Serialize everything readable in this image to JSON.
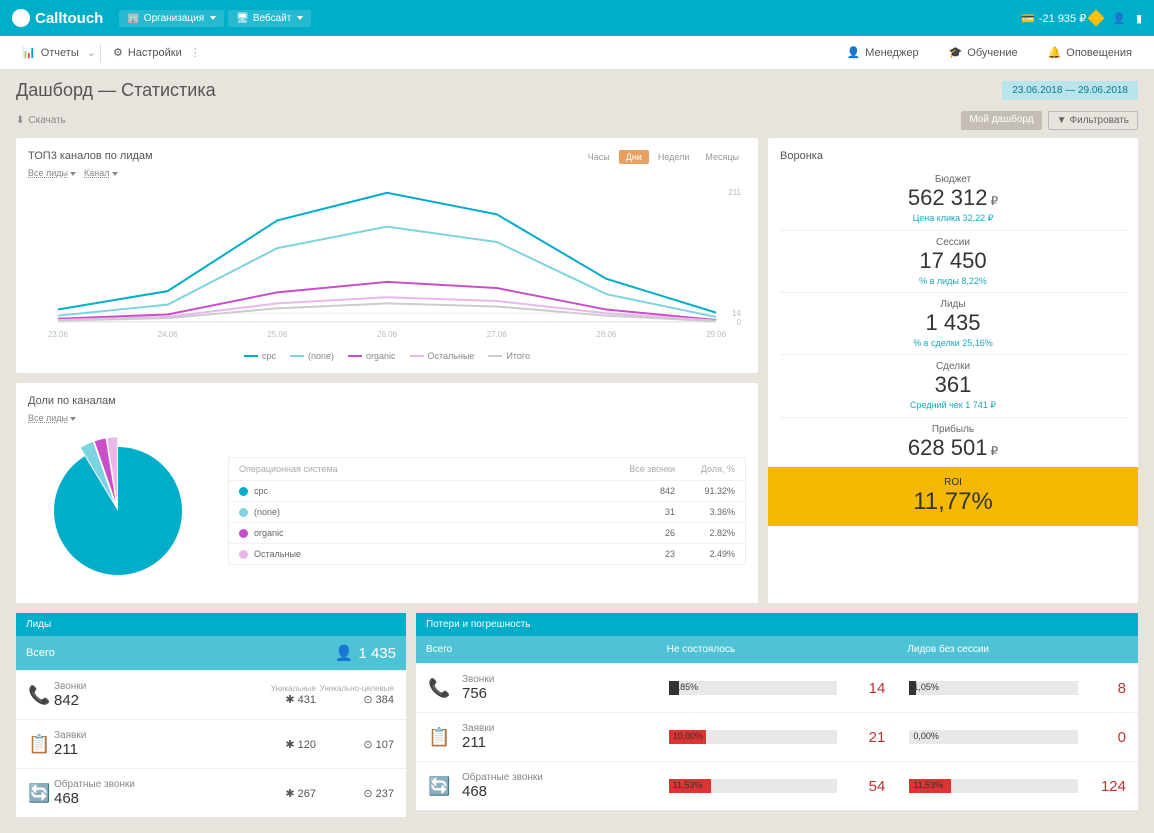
{
  "brand": "Calltouch",
  "breadcrumb": {
    "org": "Организация",
    "site": "Вебсайт"
  },
  "balance": "-21 935 ₽",
  "nav": {
    "reports": "Отчеты",
    "settings": "Настройки",
    "manager": "Менеджер",
    "training": "Обучение",
    "alerts": "Оповещения"
  },
  "page": {
    "title": "Дашборд — Статистика",
    "date_range": "23.06.2018 — 29.06.2018",
    "download": "Скачать",
    "my_dashboard": "Мой дашборд",
    "filter": "Фильтровать"
  },
  "top_channels": {
    "title": "ТОП3 каналов по лидам",
    "filter_leads": "Все лиды",
    "filter_channel": "Канал",
    "tabs": [
      "Часы",
      "Дни",
      "Недели",
      "Месяцы"
    ],
    "active_tab": 1,
    "ymax": "211",
    "ymid": "14",
    "ymin": "0",
    "legend": [
      {
        "name": "cpc",
        "color": "#00aec9"
      },
      {
        "name": "(none)",
        "color": "#7dd3e0"
      },
      {
        "name": "organic",
        "color": "#c94fc9"
      },
      {
        "name": "Остальные",
        "color": "#e8b8e8"
      },
      {
        "name": "Итого",
        "color": "#cccccc"
      }
    ]
  },
  "chart_data": {
    "type": "line",
    "categories": [
      "23.06",
      "24.06",
      "25.06",
      "26.06",
      "27.06",
      "28.06",
      "29.06"
    ],
    "ylim": [
      0,
      211
    ],
    "series": [
      {
        "name": "cpc",
        "color": "#00aec9",
        "values": [
          20,
          50,
          165,
          210,
          175,
          70,
          15
        ]
      },
      {
        "name": "(none)",
        "color": "#7dd3e0",
        "values": [
          10,
          28,
          120,
          155,
          130,
          45,
          8
        ]
      },
      {
        "name": "organic",
        "color": "#c94fc9",
        "values": [
          5,
          12,
          48,
          65,
          55,
          20,
          3
        ]
      },
      {
        "name": "Остальные",
        "color": "#e8b8e8",
        "values": [
          3,
          8,
          30,
          40,
          34,
          14,
          2
        ]
      },
      {
        "name": "Итого",
        "color": "#cccccc",
        "values": [
          2,
          6,
          22,
          30,
          25,
          10,
          1
        ]
      }
    ]
  },
  "funnel": {
    "title": "Воронка",
    "steps": [
      {
        "label": "Бюджет",
        "value": "562 312",
        "suffix": "₽",
        "note": "Цена клика  32,22 ₽"
      },
      {
        "label": "Сессии",
        "value": "17 450",
        "suffix": "",
        "note": "% в лиды  8,22%"
      },
      {
        "label": "Лиды",
        "value": "1 435",
        "suffix": "",
        "note": "% в сделки  25,16%"
      },
      {
        "label": "Сделки",
        "value": "361",
        "suffix": "",
        "note": "Средний чек  1 741 ₽"
      },
      {
        "label": "Прибыль",
        "value": "628 501",
        "suffix": "₽",
        "note": ""
      }
    ],
    "roi_label": "ROI",
    "roi_value": "11,77%"
  },
  "shares": {
    "title": "Доли по каналам",
    "filter": "Все лиды",
    "table_head": {
      "c1": "Операционная система",
      "c2": "Все звонки",
      "c3": "Доля, %"
    },
    "rows": [
      {
        "name": "cpc",
        "color": "#00aec9",
        "calls": "842",
        "share": "91.32%"
      },
      {
        "name": "(none)",
        "color": "#7dd3e0",
        "calls": "31",
        "share": "3.36%"
      },
      {
        "name": "organic",
        "color": "#c94fc9",
        "calls": "26",
        "share": "2.82%"
      },
      {
        "name": "Остальные",
        "color": "#e8b8e8",
        "calls": "23",
        "share": "2.49%"
      }
    ]
  },
  "leads": {
    "title": "Лиды",
    "total_label": "Всего",
    "total": "1 435",
    "col_unique": "Уникальные",
    "col_unique_goal": "Уникально-целевые",
    "rows": [
      {
        "icon": "phone",
        "label": "Звонки",
        "value": "842",
        "unique": "431",
        "goal": "384"
      },
      {
        "icon": "form",
        "label": "Заявки",
        "value": "211",
        "unique": "120",
        "goal": "107"
      },
      {
        "icon": "callback",
        "label": "Обратные звонки",
        "value": "468",
        "unique": "267",
        "goal": "237"
      }
    ]
  },
  "losses": {
    "title": "Потери и погрешность",
    "col_total": "Всего",
    "col_missed": "Не состоялось",
    "col_nosession": "Лидов без сессии",
    "rows": [
      {
        "icon": "phone",
        "label": "Звонки",
        "value": "756",
        "missed_pct": "1,85%",
        "missed_val": "14",
        "missed_w": 6,
        "missed_c": "#333",
        "ns_pct": "1,05%",
        "ns_val": "8",
        "ns_w": 4,
        "ns_c": "#333"
      },
      {
        "icon": "form",
        "label": "Заявки",
        "value": "211",
        "missed_pct": "10,00%",
        "missed_val": "21",
        "missed_w": 22,
        "missed_c": "#d33",
        "ns_pct": "0,00%",
        "ns_val": "0",
        "ns_w": 0,
        "ns_c": "#333"
      },
      {
        "icon": "callback",
        "label": "Обратные звонки",
        "value": "468",
        "missed_pct": "11,53%",
        "missed_val": "54",
        "missed_w": 25,
        "missed_c": "#d33",
        "ns_pct": "11,53%",
        "ns_val": "124",
        "ns_w": 25,
        "ns_c": "#d33"
      }
    ]
  }
}
